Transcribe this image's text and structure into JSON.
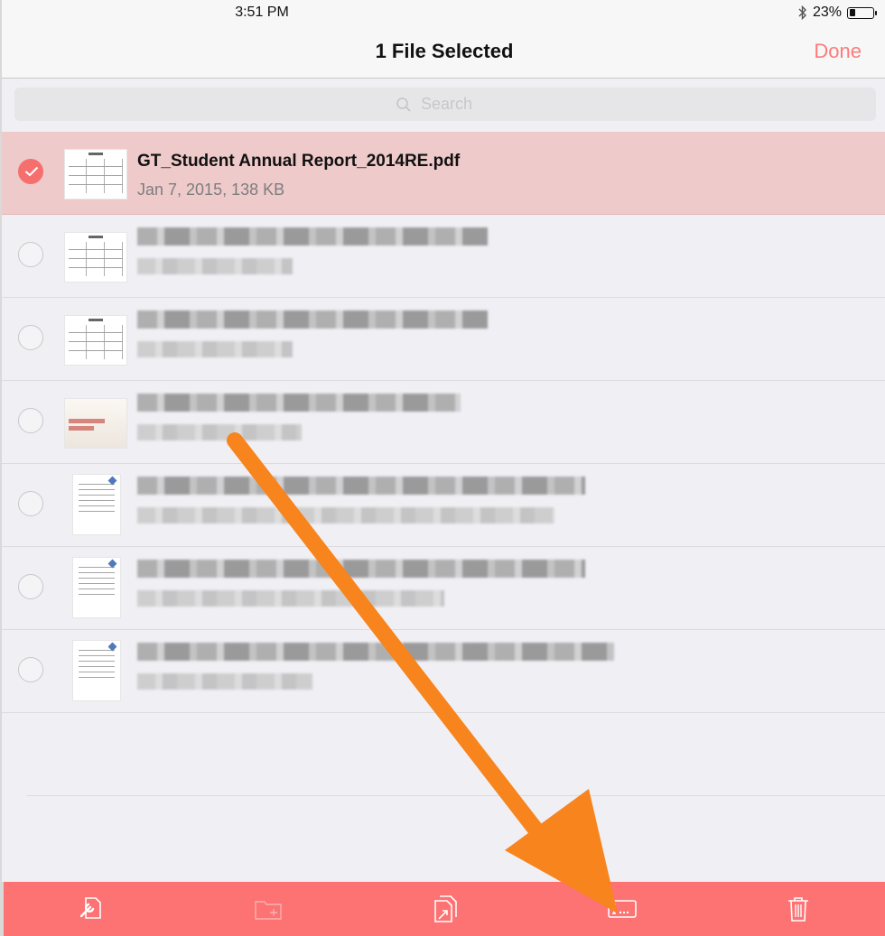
{
  "status_bar": {
    "time": "3:51 PM",
    "battery_label": "23%",
    "battery_level": 0.23
  },
  "nav": {
    "title": "1 File Selected",
    "done_label": "Done"
  },
  "search": {
    "placeholder": "Search"
  },
  "files": [
    {
      "name": "GT_Student Annual Report_2014RE.pdf",
      "meta": "Jan 7, 2015, 138 KB",
      "selected": true,
      "thumb": "table-document"
    },
    {
      "name": "",
      "meta": "",
      "selected": false,
      "thumb": "table-document"
    },
    {
      "name": "",
      "meta": "",
      "selected": false,
      "thumb": "table-document"
    },
    {
      "name": "",
      "meta": "",
      "selected": false,
      "thumb": "presentation-slide"
    },
    {
      "name": "",
      "meta": "",
      "selected": false,
      "thumb": "form-document"
    },
    {
      "name": "",
      "meta": "",
      "selected": false,
      "thumb": "form-document"
    },
    {
      "name": "",
      "meta": "",
      "selected": false,
      "thumb": "form-document"
    }
  ],
  "toolbar": {
    "items": [
      {
        "icon": "wrench-document-icon",
        "enabled": true
      },
      {
        "icon": "new-folder-icon",
        "enabled": false
      },
      {
        "icon": "duplicate-icon",
        "enabled": true
      },
      {
        "icon": "rename-icon",
        "enabled": true
      },
      {
        "icon": "trash-icon",
        "enabled": true
      }
    ]
  },
  "colors": {
    "accent": "#fd7272",
    "selected_row": "#efcaca",
    "annotation_arrow": "#f7841c"
  }
}
